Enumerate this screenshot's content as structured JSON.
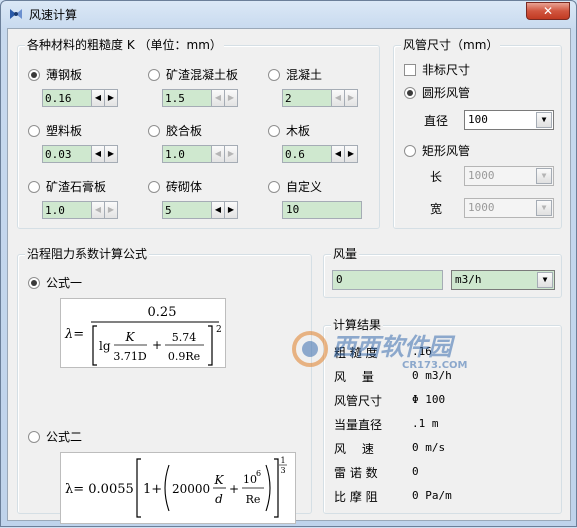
{
  "window": {
    "title": "风速计算",
    "close_glyph": "✕"
  },
  "roughness": {
    "legend": "各种材料的粗糙度 K （单位：mm）",
    "materials": [
      {
        "label": "薄钢板",
        "value": "0.16",
        "selected": true,
        "enabled": true
      },
      {
        "label": "矿渣混凝土板",
        "value": "1.5",
        "selected": false,
        "enabled": false
      },
      {
        "label": "混凝土",
        "value": "2",
        "selected": false,
        "enabled": false
      },
      {
        "label": "塑料板",
        "value": "0.03",
        "selected": false,
        "enabled": true
      },
      {
        "label": "胶合板",
        "value": "1.0",
        "selected": false,
        "enabled": false
      },
      {
        "label": "木板",
        "value": "0.6",
        "selected": false,
        "enabled": true
      },
      {
        "label": "矿渣石膏板",
        "value": "1.0",
        "selected": false,
        "enabled": false
      },
      {
        "label": "砖砌体",
        "value": "5",
        "selected": false,
        "enabled": true
      },
      {
        "label": "自定义",
        "value": "10",
        "selected": false,
        "enabled": false
      }
    ]
  },
  "duct": {
    "legend": "风管尺寸（mm）",
    "nonstandard_label": "非标尺寸",
    "round_label": "圆形风管",
    "diameter_label": "直径",
    "diameter_value": "100",
    "rect_label": "矩形风管",
    "length_label": "长",
    "length_value": "1000",
    "width_label": "宽",
    "width_value": "1000"
  },
  "formula": {
    "legend": "沿程阻力系数计算公式",
    "option1": "公式一",
    "option2": "公式二",
    "f1": {
      "lambda": "λ=",
      "num": "0.25",
      "lg": "lg",
      "K": "K",
      "d1": "3.71D",
      "plus": "+",
      "n2": "5.74",
      "d2": "0.9Re",
      "sq": "2"
    },
    "f2": {
      "lhs": "λ= 0.0055",
      "one": "1+",
      "coef": "20000",
      "K": "K",
      "d": "d",
      "plus": "+",
      "pow6": "10",
      "e6": "6",
      "Re": "Re",
      "e13n": "1",
      "e13d": "3"
    }
  },
  "airflow": {
    "legend": "风量",
    "value": "0",
    "unit": "m3/h"
  },
  "results": {
    "legend": "计算结果",
    "rows": [
      {
        "label": "粗 糙 度",
        "value": ".16"
      },
      {
        "label": "风　 量",
        "value": "0 m3/h"
      },
      {
        "label": "风管尺寸",
        "value": "Φ 100"
      },
      {
        "label": "当量直径",
        "value": ".1 m"
      },
      {
        "label": "风　 速",
        "value": "0 m/s"
      },
      {
        "label": "雷 诺 数",
        "value": "0"
      },
      {
        "label": "比 摩 阻",
        "value": "0 Pa/m"
      }
    ]
  },
  "watermark": {
    "brand": "西西软件园",
    "domain": "CR173.COM"
  },
  "icons": {
    "app": "app-icon",
    "spin_left": "◀",
    "spin_right": "▶",
    "dropdown": "▼"
  }
}
